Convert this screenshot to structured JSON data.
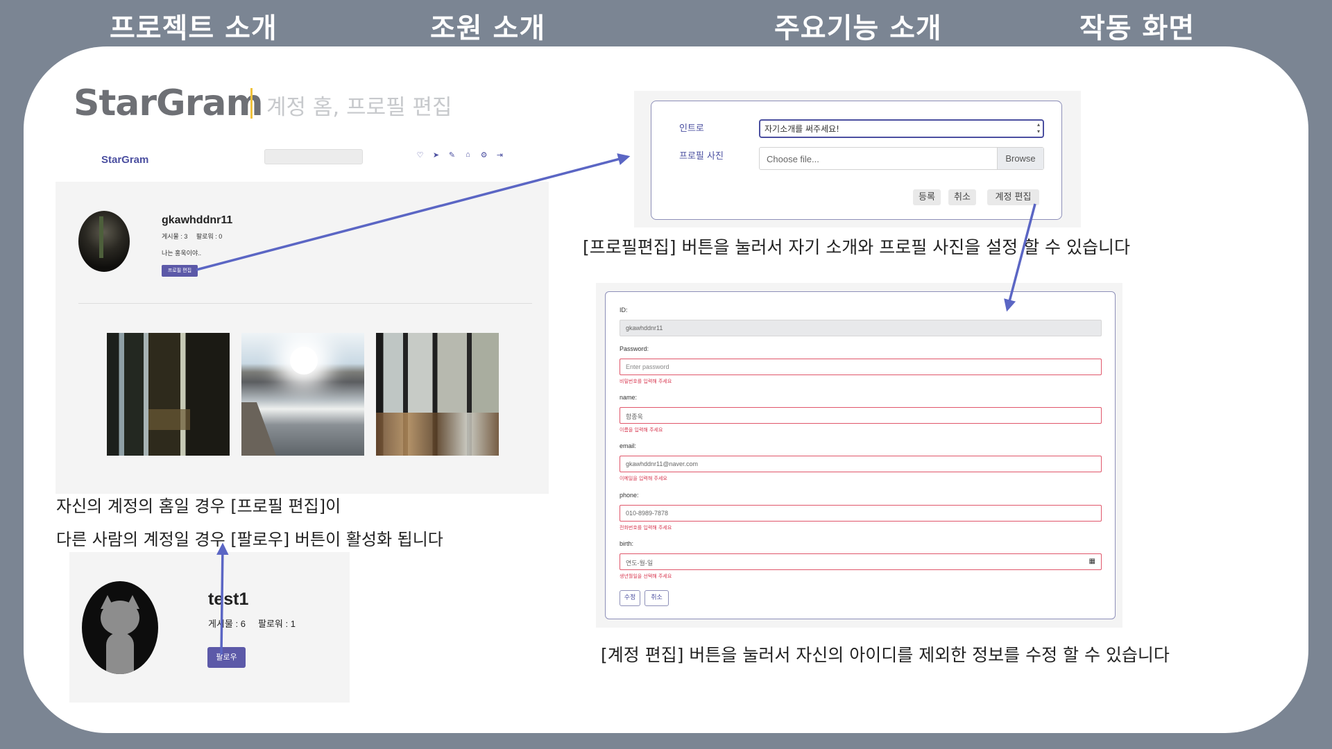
{
  "top_nav": [
    "프로젝트 소개",
    "조원 소개",
    "주요기능 소개",
    "작동 화면"
  ],
  "header": {
    "brand": "StarGram",
    "subtitle": "계정 홈, 프로필 편집"
  },
  "profile_page": {
    "nav_brand": "StarGram",
    "nav_icons": [
      "heart-icon",
      "send-icon",
      "pencil-icon",
      "home-icon",
      "gear-icon",
      "logout-icon"
    ],
    "username": "gkawhddnr11",
    "stats": "게시물 : 3     팔로워 : 0",
    "intro": "나는 홍욱이야..",
    "edit_button": "프로필 편집"
  },
  "captions": {
    "left_1": "자신의 계정의 홈일 경우 [프로필 편집]이",
    "left_2": "다른 사람의 계정일 경우 [팔로우] 버튼이 활성화 됩니다",
    "right_1": "[프로필편집] 버튼을 눌러서 자기 소개와 프로필 사진을 설정 할 수 있습니다",
    "right_2": "[계정 편집] 버튼을 눌러서 자신의 아이디를 제외한 정보를 수정 할 수 있습니다"
  },
  "other_profile": {
    "username": "test1",
    "stats": "게시물 : 6     팔로워 : 1",
    "follow_button": "팔로우"
  },
  "intro_form": {
    "intro_label": "인트로",
    "intro_value": "자기소개를 써주세요!",
    "photo_label": "프로필 사진",
    "file_placeholder": "Choose file...",
    "browse_label": "Browse",
    "register_button": "등록",
    "cancel_button": "취소",
    "account_edit_button": "계정 편집"
  },
  "account_form": {
    "id_label": "ID:",
    "id_value": "gkawhddnr11",
    "password_label": "Password:",
    "password_placeholder": "Enter password",
    "password_error": "비밀번호를 입력해 주세요",
    "name_label": "name:",
    "name_value": "함종욱",
    "name_error": "이름을 입력해 주세요",
    "email_label": "email:",
    "email_value": "gkawhddnr11@naver.com",
    "email_error": "이메일을 입력해 주세요",
    "phone_label": "phone:",
    "phone_value": "010-8989-7878",
    "phone_error": "전화번호를 입력해 주세요",
    "birth_label": "birth:",
    "birth_placeholder": "연도-월-일",
    "birth_error": "생년월일을 선택해 주세요",
    "submit_button": "수정",
    "cancel_button": "취소"
  },
  "colors": {
    "accent": "#5c59a8",
    "arrow": "#5b66c4",
    "error": "#d83a52",
    "background": "#7b8593"
  }
}
